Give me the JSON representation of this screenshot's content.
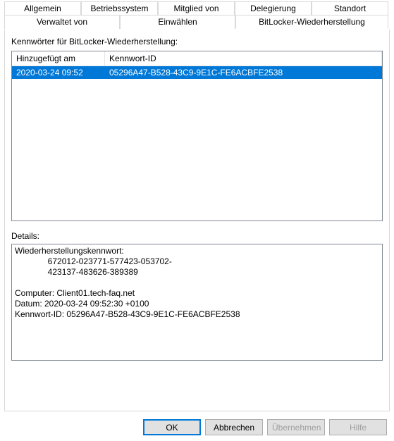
{
  "tabs": {
    "row1": [
      {
        "label": "Allgemein"
      },
      {
        "label": "Betriebssystem"
      },
      {
        "label": "Mitglied von"
      },
      {
        "label": "Delegierung"
      },
      {
        "label": "Standort"
      }
    ],
    "row2": [
      {
        "label": "Verwaltet von"
      },
      {
        "label": "Einwählen"
      },
      {
        "label": "BitLocker-Wiederherstellung"
      }
    ]
  },
  "passwords_label": "Kennwörter für BitLocker-Wiederherstellung:",
  "columns": {
    "added": "Hinzugefügt am",
    "pwid": "Kennwort-ID"
  },
  "rows": [
    {
      "added": "2020-03-24 09:52",
      "pwid": "05296A47-B528-43C9-9E1C-FE6ACBFE2538"
    }
  ],
  "details_label": "Details:",
  "details_text": "Wiederherstellungskennwort:\n              672012-023771-577423-053702-\n              423137-483626-389389\n\nComputer: Client01.tech-faq.net\nDatum: 2020-03-24 09:52:30 +0100\nKennwort-ID: 05296A47-B528-43C9-9E1C-FE6ACBFE2538",
  "buttons": {
    "ok": "OK",
    "cancel": "Abbrechen",
    "apply": "Übernehmen",
    "help": "Hilfe"
  }
}
